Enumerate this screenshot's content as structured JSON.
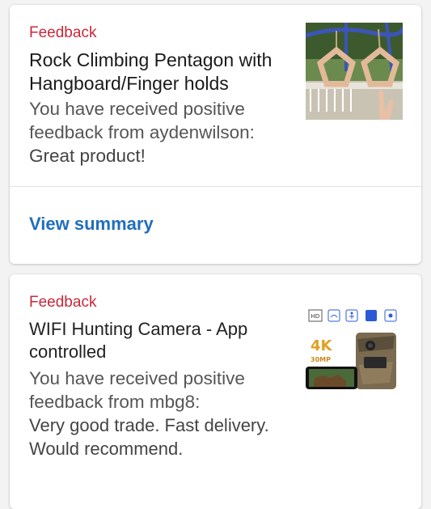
{
  "notifications": [
    {
      "label": "Feedback",
      "title": "Rock Climbing Pentagon with Hangboard/Finger holds",
      "message": "You have received positive feedback from aydenwilson:",
      "comment": "Great product!",
      "action": "View summary",
      "image": "climbing-pentagon-photo"
    },
    {
      "label": "Feedback",
      "title": "WIFI Hunting Camera - App controlled",
      "message": "You have received positive feedback from mbg8:",
      "comment": "Very good trade. Fast delivery. Would recommend.",
      "image": "hunting-camera-photo",
      "image_badges": [
        "HD",
        "4K",
        "30MP"
      ]
    }
  ],
  "colors": {
    "label": "#c8283b",
    "link": "#1f6ebd",
    "background": "#f3f3f3",
    "card": "#ffffff"
  }
}
